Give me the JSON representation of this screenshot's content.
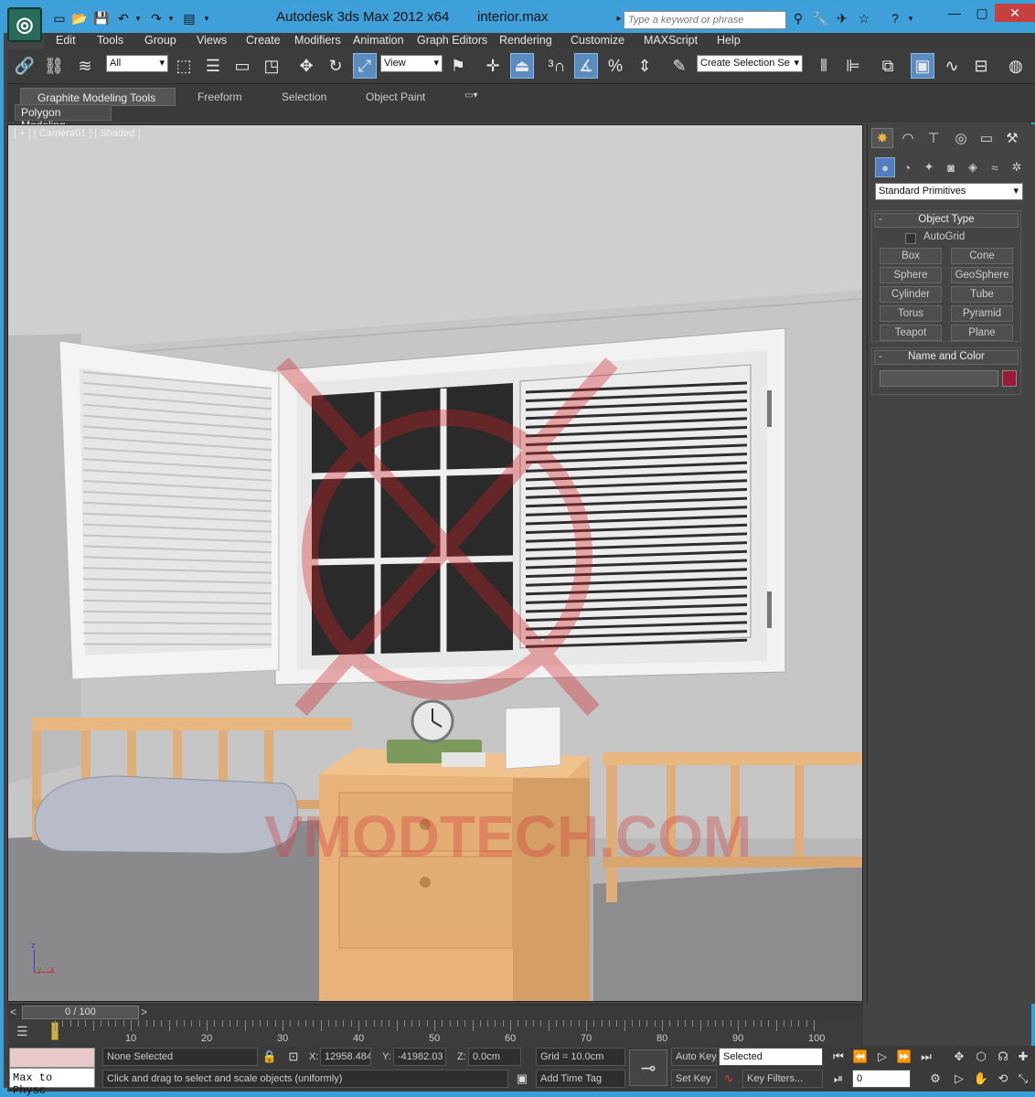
{
  "window": {
    "app_title": "Autodesk 3ds Max  2012 x64",
    "file_name": "interior.max",
    "search_placeholder": "Type a keyword or phrase"
  },
  "menu": [
    "Edit",
    "Tools",
    "Group",
    "Views",
    "Create",
    "Modifiers",
    "Animation",
    "Graph Editors",
    "Rendering",
    "Customize",
    "MAXScript",
    "Help"
  ],
  "toolbar": {
    "selection_filter": "All",
    "reference_coord": "View",
    "named_selection": "Create Selection Se"
  },
  "ribbon": {
    "tabs": [
      "Graphite Modeling Tools",
      "Freeform",
      "Selection",
      "Object Paint"
    ],
    "panel": "Polygon Modeling"
  },
  "viewport": {
    "label": "[ + ] [ Camera01 ] [ Shaded ]",
    "watermark": "VMODTECH.COM",
    "axis": {
      "z": "z",
      "y": "y",
      "x": "x"
    }
  },
  "command_panel": {
    "primitive_type": "Standard Primitives",
    "object_type": {
      "title": "Object Type",
      "autogrid": "AutoGrid",
      "buttons": [
        "Box",
        "Cone",
        "Sphere",
        "GeoSphere",
        "Cylinder",
        "Tube",
        "Torus",
        "Pyramid",
        "Teapot",
        "Plane"
      ]
    },
    "name_color": {
      "title": "Name and Color",
      "name_value": "",
      "color": "#9a1a3a"
    }
  },
  "timeline": {
    "frame_display": "0 / 100",
    "frame_current": 0,
    "frame_total": 100,
    "ticks": [
      "10",
      "20",
      "30",
      "40",
      "50",
      "60",
      "70",
      "80",
      "90",
      "100"
    ]
  },
  "status": {
    "script_listener": "Max to Physc",
    "selection": "None Selected",
    "prompt": "Click and drag to select and scale objects (uniformly)",
    "x_label": "X:",
    "x_value": "12958.484",
    "y_label": "Y:",
    "y_value": "-41982.03",
    "z_label": "Z:",
    "z_value": "0.0cm",
    "grid": "Grid = 10.0cm",
    "add_time_tag": "Add Time Tag",
    "auto_key": "Auto Key",
    "key_mode": "Selected",
    "set_key": "Set Key",
    "key_filters": "Key Filters...",
    "frame_field": "0"
  }
}
